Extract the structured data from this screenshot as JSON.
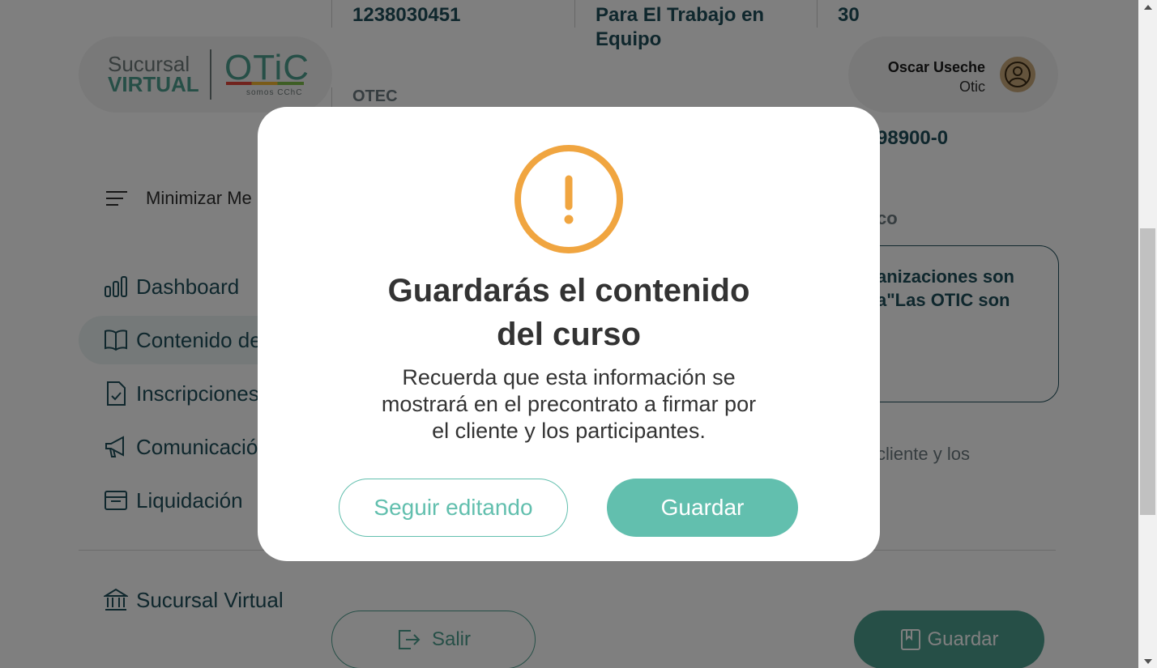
{
  "header": {
    "logo": {
      "sucursal": "Sucursal",
      "virtual": "VIRTUAL",
      "otic": "OTiC",
      "tagline": "somos CChC"
    },
    "user": {
      "name": "Oscar Useche",
      "role": "Otic",
      "icon": "user-circle-icon"
    }
  },
  "background": {
    "info": {
      "code_value": "1238030451",
      "course_name": "Para El Trabajo en Equipo",
      "hours_value": "30",
      "otec_label": "OTEC",
      "otec_rut_partial": "98900-0",
      "section_partial": "co",
      "textbox_line1": "anizaciones son",
      "textbox_line2": "a\"Las OTIC son",
      "note_partial": "cliente y los"
    },
    "sidebar": {
      "minimize_label": "Minimizar Me",
      "items": [
        {
          "label": "Dashboard",
          "icon": "bar-chart-icon"
        },
        {
          "label": "Contenido de",
          "icon": "open-book-icon"
        },
        {
          "label": "Inscripciones",
          "icon": "document-check-icon"
        },
        {
          "label": "Comunicació",
          "icon": "megaphone-icon"
        },
        {
          "label": "Liquidación",
          "icon": "archive-box-icon"
        }
      ],
      "branch_label": "Sucursal Virtual",
      "branch_icon": "bank-icon"
    },
    "footer_buttons": {
      "exit_label": "Salir",
      "save_label": "Guardar"
    }
  },
  "modal": {
    "icon": "warning-circle-icon",
    "accent_color": "#f0a540",
    "title": "Guardarás el contenido del curso",
    "body": "Recuerda que esta información se mostrará en el precontrato a firmar por el cliente y los participantes.",
    "secondary_label": "Seguir editando",
    "primary_label": "Guardar",
    "primary_color": "#62bfae"
  }
}
